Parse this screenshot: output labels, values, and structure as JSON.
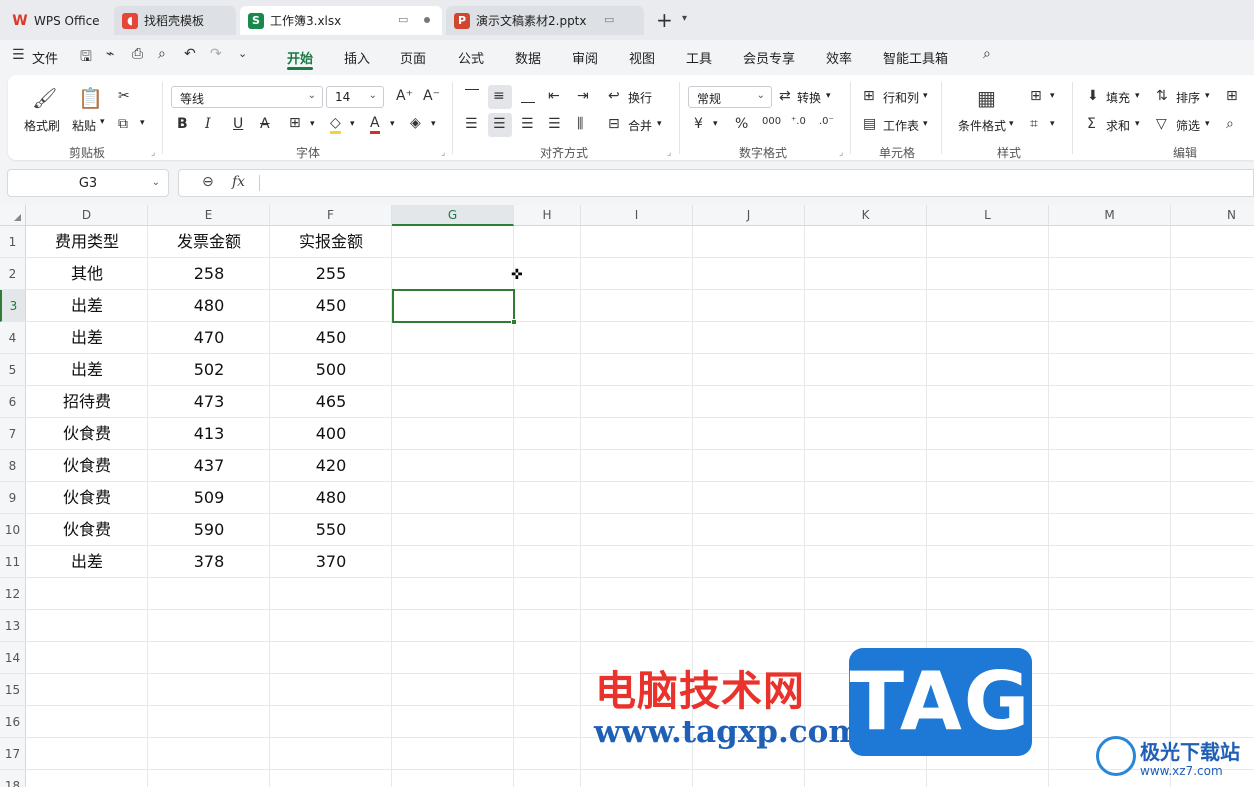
{
  "tabs": [
    {
      "label": "WPS Office",
      "icon": "wps-logo-icon"
    },
    {
      "label": "找稻壳模板",
      "icon": "docer-icon"
    },
    {
      "label": "工作簿3.xlsx",
      "icon": "spreadsheet-icon"
    },
    {
      "label": "演示文稿素材2.pptx",
      "icon": "presentation-icon"
    }
  ],
  "menu": {
    "file": "文件",
    "items": [
      "开始",
      "插入",
      "页面",
      "公式",
      "数据",
      "审阅",
      "视图",
      "工具",
      "会员专享",
      "效率",
      "智能工具箱"
    ],
    "active": "开始"
  },
  "ribbon": {
    "clipboard": {
      "format_painter": "格式刷",
      "paste": "粘贴",
      "label": "剪贴板"
    },
    "font": {
      "name": "等线",
      "size": "14",
      "label": "字体"
    },
    "align": {
      "wrap": "换行",
      "merge": "合并",
      "label": "对齐方式"
    },
    "number": {
      "format": "常规",
      "convert": "转换",
      "label": "数字格式"
    },
    "cells": {
      "rows_cols": "行和列",
      "sheet": "工作表",
      "label": "单元格"
    },
    "styles": {
      "cond_format": "条件格式",
      "label": "样式"
    },
    "edit": {
      "fill": "填充",
      "sort": "排序",
      "sum": "求和",
      "filter": "筛选",
      "label": "编辑"
    }
  },
  "formula_bar": {
    "name_box": "G3",
    "fx": "fx",
    "value": ""
  },
  "grid": {
    "columns": [
      "D",
      "E",
      "F",
      "G",
      "H",
      "I",
      "J",
      "K",
      "L",
      "M",
      "N"
    ],
    "selected_column": "G",
    "rows": [
      "1",
      "2",
      "3",
      "4",
      "5",
      "6",
      "7",
      "8",
      "9",
      "10",
      "11",
      "12",
      "13",
      "14",
      "15",
      "16",
      "17",
      "18"
    ],
    "selected_row": "3",
    "data": [
      [
        "费用类型",
        "发票金额",
        "实报金额"
      ],
      [
        "其他",
        "258",
        "255"
      ],
      [
        "出差",
        "480",
        "450"
      ],
      [
        "出差",
        "470",
        "450"
      ],
      [
        "出差",
        "502",
        "500"
      ],
      [
        "招待费",
        "473",
        "465"
      ],
      [
        "伙食费",
        "413",
        "400"
      ],
      [
        "伙食费",
        "437",
        "420"
      ],
      [
        "伙食费",
        "509",
        "480"
      ],
      [
        "伙食费",
        "590",
        "550"
      ],
      [
        "出差",
        "378",
        "370"
      ]
    ]
  },
  "watermark": {
    "cn": "电脑技术网",
    "url": "www.tagxp.com",
    "tag": "TAG",
    "site_cn": "极光下载站",
    "site_url": "www.xz7.com"
  },
  "colors": {
    "accent": "#1a7a44",
    "selection": "#2e7d32",
    "tag_blue": "#1e78d6",
    "wm_red": "#e8322b"
  }
}
